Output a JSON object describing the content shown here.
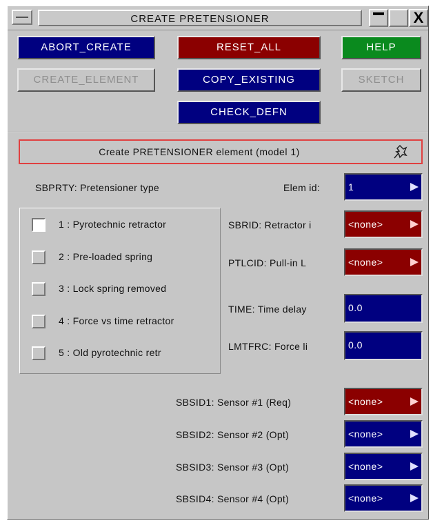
{
  "window": {
    "title": "CREATE PRETENSIONER",
    "maximize_glyph": "",
    "close_glyph": "X"
  },
  "toolbar": {
    "abort_create": "ABORT_CREATE",
    "reset_all": "RESET_ALL",
    "help": "HELP",
    "create_element": "CREATE_ELEMENT",
    "copy_existing": "COPY_EXISTING",
    "sketch": "SKETCH",
    "check_defn": "CHECK_DEFN"
  },
  "info": {
    "text": "Create PRETENSIONER element (model 1)",
    "icon": "pin-icon"
  },
  "type_section": {
    "label": "SBPRTY: Pretensioner type",
    "options": [
      {
        "label": "1 : Pyrotechnic retractor",
        "selected": true
      },
      {
        "label": "2 : Pre-loaded spring",
        "selected": false
      },
      {
        "label": "3 : Lock spring removed",
        "selected": false
      },
      {
        "label": "4 : Force vs time retractor",
        "selected": false
      },
      {
        "label": "5 : Old pyrotechnic retr",
        "selected": false
      }
    ]
  },
  "fields": {
    "elem_id": {
      "label": "Elem id:",
      "value": "1"
    },
    "sbrid": {
      "label": "SBRID: Retractor i",
      "value": "<none>"
    },
    "ptlcid": {
      "label": "PTLCID: Pull-in L",
      "value": "<none>"
    },
    "time": {
      "label": "TIME: Time delay",
      "value": "0.0"
    },
    "lmtfrc": {
      "label": "LMTFRC: Force li",
      "value": "0.0"
    }
  },
  "sensors": [
    {
      "label": "SBSID1: Sensor #1 (Req)",
      "value": "<none>"
    },
    {
      "label": "SBSID2: Sensor #2 (Opt)",
      "value": "<none>"
    },
    {
      "label": "SBSID3: Sensor #3 (Opt)",
      "value": "<none>"
    },
    {
      "label": "SBSID4: Sensor #4 (Opt)",
      "value": "<none>"
    }
  ],
  "colors": {
    "blue": "#000080",
    "red": "#8b0000",
    "green": "#0a8a1e",
    "panel": "#c6c6c6"
  }
}
